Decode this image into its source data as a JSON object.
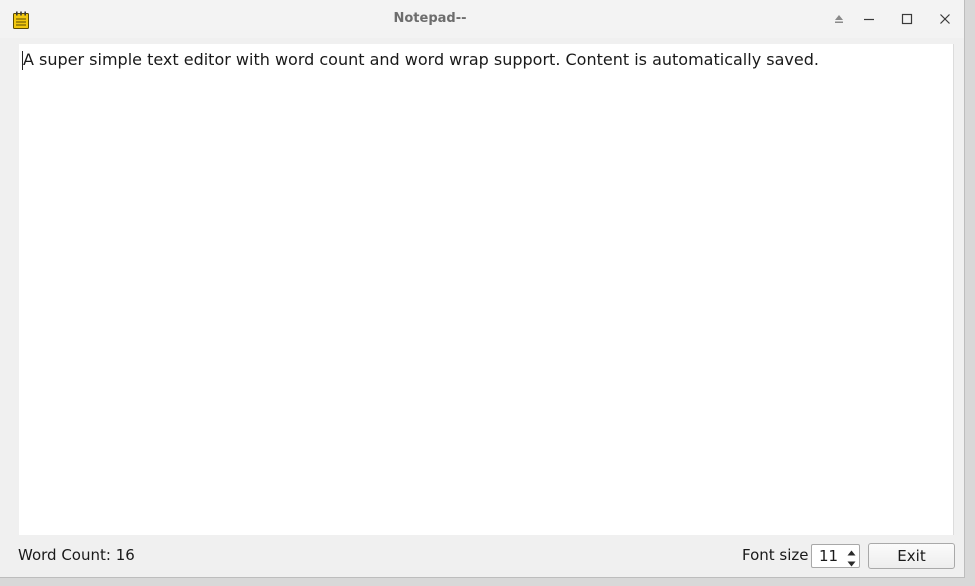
{
  "window": {
    "title": "Notepad--",
    "icon": "notepad-icon"
  },
  "titlebar_buttons": {
    "shade": "shade-icon",
    "minimize": "minimize-icon",
    "maximize": "maximize-icon",
    "close": "close-icon"
  },
  "editor": {
    "content": "A super simple text editor with word count and word wrap support. Content is automatically saved."
  },
  "statusbar": {
    "word_count": "Word Count: 16",
    "font_size_label": "Font size",
    "font_size_value": "11",
    "exit_label": "Exit"
  },
  "colors": {
    "window_bg": "#f0f0f0",
    "editor_bg": "#ffffff",
    "icon_yellow": "#f2c80f",
    "title_text": "#6d6d6d"
  }
}
